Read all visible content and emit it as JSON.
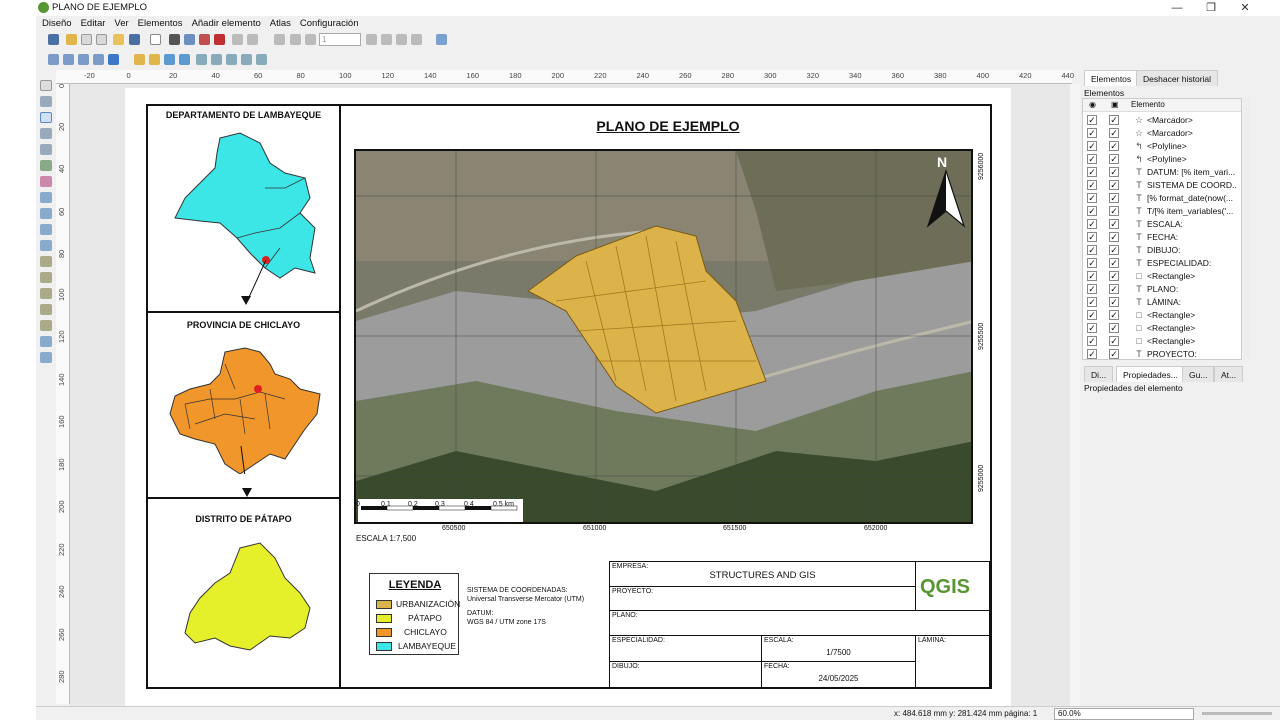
{
  "window": {
    "title": "PLANO DE EJEMPLO"
  },
  "menu": [
    "Diseño",
    "Editar",
    "Ver",
    "Elementos",
    "Añadir elemento",
    "Atlas",
    "Configuración"
  ],
  "toolbar": {
    "page_value": "1"
  },
  "ruler_top_labels": [
    "-20",
    "0",
    "20",
    "40",
    "60",
    "80",
    "100",
    "120",
    "140",
    "160",
    "180",
    "200",
    "220",
    "240",
    "260",
    "280",
    "300",
    "320",
    "340",
    "360",
    "380",
    "400",
    "420",
    "440"
  ],
  "ruler_left_labels": [
    "0",
    "20",
    "40",
    "60",
    "80",
    "100",
    "120",
    "140",
    "160",
    "180",
    "200",
    "220",
    "240",
    "260",
    "280"
  ],
  "layout": {
    "panel1_title": "DEPARTAMENTO DE LAMBAYEQUE",
    "panel2_title": "PROVINCIA DE CHICLAYO",
    "panel3_title": "DISTRITO DE PÁTAPO",
    "map_title": "PLANO DE EJEMPLO",
    "north": "N",
    "grid_right_labels": [
      "9256000",
      "9255500",
      "9255000"
    ],
    "grid_bottom_labels": [
      "650500",
      "651000",
      "651500",
      "652000"
    ],
    "scalebar_labels": [
      "0",
      "0.1",
      "0.2",
      "0.3",
      "0.4",
      "0.5 km"
    ],
    "scale_text": "ESCALA  1:7,500",
    "legend": {
      "title": "LEYENDA",
      "items": [
        {
          "label": "URBANIZACIÓN",
          "color": "#dcb24a"
        },
        {
          "label": "PÁTAPO",
          "color": "#e6f02a"
        },
        {
          "label": "CHICLAYO",
          "color": "#f0962a"
        },
        {
          "label": "LAMBAYEQUE",
          "color": "#3ce6e6"
        }
      ]
    },
    "crs": {
      "line1": "SISTEMA DE COORDENADAS:",
      "line2": "Universal Transverse Mercator (UTM)",
      "line3": "DATUM:",
      "line4": "WGS 84 / UTM zone 17S"
    },
    "titleblock": {
      "empresa_label": "EMPRESA:",
      "empresa_value": "STRUCTURES AND GIS",
      "proyecto_label": "PROYECTO:",
      "plano_label": "PLANO:",
      "especialidad_label": "ESPECIALIDAD:",
      "escala_label": "ESCALA:",
      "escala_value": "1/7500",
      "lamina_label": "LÁMINA:",
      "dibujo_label": "DIBUJO:",
      "fecha_label": "FECHA:",
      "fecha_value": "24/05/2025",
      "logo_text": "QGIS"
    }
  },
  "panel": {
    "tabs": [
      "Elementos",
      "Deshacer historial"
    ],
    "header": "Elementos",
    "column": "Elemento",
    "items": [
      {
        "icon": "☆",
        "label": "<Marcador>"
      },
      {
        "icon": "☆",
        "label": "<Marcador>"
      },
      {
        "icon": "↰",
        "label": "<Polyline>"
      },
      {
        "icon": "↰",
        "label": "<Polyline>"
      },
      {
        "icon": "T",
        "label": "DATUM: [% item_vari..."
      },
      {
        "icon": "T",
        "label": "SISTEMA DE COORD..."
      },
      {
        "icon": "T",
        "label": "[% format_date(now(..."
      },
      {
        "icon": "T",
        "label": "T/[% item_variables('..."
      },
      {
        "icon": "T",
        "label": "ESCALA:"
      },
      {
        "icon": "T",
        "label": "FECHA:"
      },
      {
        "icon": "T",
        "label": "DIBUJO:"
      },
      {
        "icon": "T",
        "label": "ESPECIALIDAD:"
      },
      {
        "icon": "□",
        "label": "<Rectangle>"
      },
      {
        "icon": "T",
        "label": "PLANO:"
      },
      {
        "icon": "T",
        "label": "LÁMINA:"
      },
      {
        "icon": "□",
        "label": "<Rectangle>"
      },
      {
        "icon": "□",
        "label": "<Rectangle>"
      },
      {
        "icon": "□",
        "label": "<Rectangle>"
      },
      {
        "icon": "T",
        "label": "PROYECTO:"
      }
    ],
    "tabs2": [
      "Di...",
      "Propiedades...",
      "Gu...",
      "At..."
    ],
    "props_title": "Propiedades del elemento"
  },
  "status": {
    "coords": "x: 484.618 mm  y: 281.424 mm  página: 1",
    "zoom": "60.0%"
  }
}
